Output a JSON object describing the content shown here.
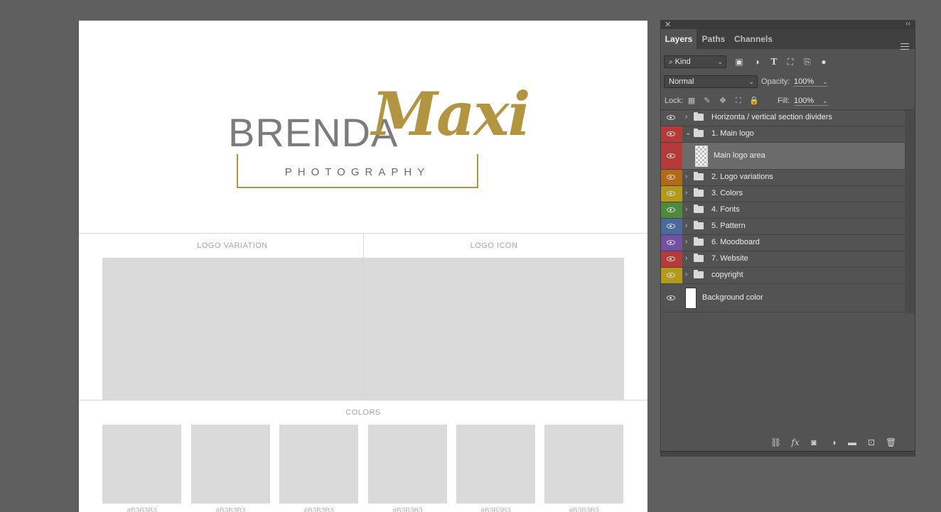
{
  "document": {
    "logo": {
      "name": "BRENDA",
      "script": "Maxi",
      "tagline": "PHOTOGRAPHY",
      "gold": "#b39440",
      "gray": "#7c7c7c"
    },
    "sections": {
      "logo_variation": "LOGO VARIATION",
      "logo_icon": "LOGO ICON",
      "colors": "COLORS"
    },
    "swatches": [
      {
        "hex": "#B3B3B3",
        "color": "#dadada"
      },
      {
        "hex": "#B3B3B3",
        "color": "#dadada"
      },
      {
        "hex": "#B3B3B3",
        "color": "#dadada"
      },
      {
        "hex": "#B3B3B3",
        "color": "#dadada"
      },
      {
        "hex": "#B3B3B3",
        "color": "#dadada"
      },
      {
        "hex": "#B3B3B3",
        "color": "#dadada"
      }
    ]
  },
  "panel": {
    "tabs": [
      "Layers",
      "Paths",
      "Channels"
    ],
    "filter": {
      "kind_label": "Kind",
      "icons": [
        "image-filter-icon",
        "adjustment-filter-icon",
        "type-filter-icon",
        "shape-filter-icon",
        "smart-object-filter-icon",
        "filter-toggle-icon"
      ]
    },
    "blend": {
      "mode": "Normal",
      "opacity_label": "Opacity:",
      "opacity": "100%"
    },
    "lock": {
      "label": "Lock:",
      "fill_label": "Fill:",
      "fill": "100%"
    },
    "layers": [
      {
        "name": "Horizonta / vertical section dividers",
        "type": "group",
        "color": "none",
        "expanded": false
      },
      {
        "name": "1. Main logo",
        "type": "group",
        "color": "#b53b3b",
        "expanded": true
      },
      {
        "name": "Main logo area",
        "type": "smart",
        "color": "#b53b3b",
        "selected": true
      },
      {
        "name": "2. Logo variations",
        "type": "group",
        "color": "#b46a14",
        "expanded": false
      },
      {
        "name": "3. Colors",
        "type": "group",
        "color": "#b39a1a",
        "expanded": false
      },
      {
        "name": "4. Fonts",
        "type": "group",
        "color": "#4e8a3c",
        "expanded": false
      },
      {
        "name": "5. Pattern",
        "type": "group",
        "color": "#4a6a9e",
        "expanded": false
      },
      {
        "name": "6. Moodboard",
        "type": "group",
        "color": "#7250a4",
        "expanded": false
      },
      {
        "name": "7. Website",
        "type": "group",
        "color": "#b53b3b",
        "expanded": false
      },
      {
        "name": "copyright",
        "type": "group",
        "color": "#b39a1a",
        "expanded": false
      },
      {
        "name": "Background color",
        "type": "fill",
        "color": "none"
      }
    ]
  }
}
